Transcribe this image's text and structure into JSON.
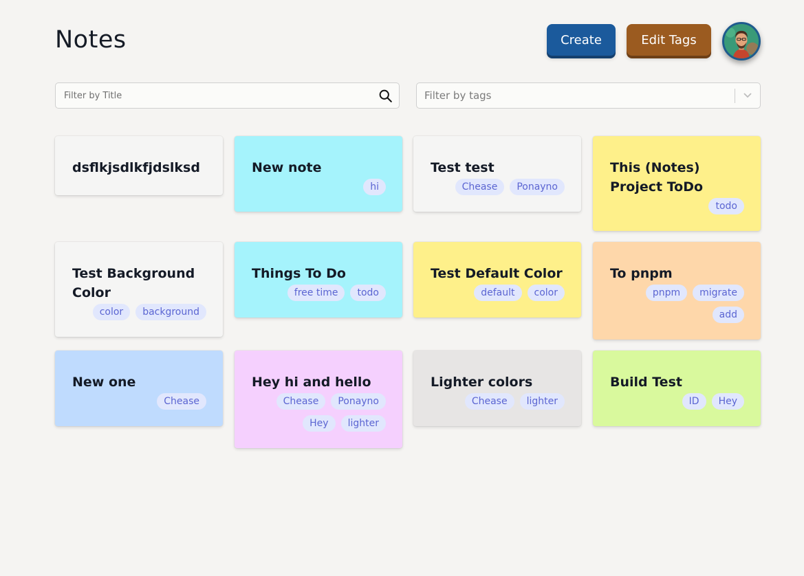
{
  "header": {
    "title": "Notes",
    "create_label": "Create",
    "edit_tags_label": "Edit Tags"
  },
  "filters": {
    "title_placeholder": "Filter by Title",
    "tags_placeholder": "Filter by tags"
  },
  "colors": {
    "white": "#f5f5f4",
    "cyan": "#a5f3fc",
    "yellow": "#fef08a",
    "orange": "#fed7aa",
    "blue": "#bfdbfe",
    "pink": "#f5d0fe",
    "gray": "#e7e5e4",
    "lime": "#d9f99d"
  },
  "notes": [
    {
      "title": "dsflkjsdlkfjdslksd",
      "color": "white",
      "tags": []
    },
    {
      "title": "New note",
      "color": "cyan",
      "tags": [
        "hi"
      ]
    },
    {
      "title": "Test test",
      "color": "white",
      "tags": [
        "Chease",
        "Ponayno"
      ]
    },
    {
      "title": "This (Notes) Project ToDo",
      "color": "yellow",
      "tags": [
        "todo"
      ]
    },
    {
      "title": "Test Background Color",
      "color": "white",
      "tags": [
        "color",
        "background"
      ]
    },
    {
      "title": "Things To Do",
      "color": "cyan",
      "tags": [
        "free time",
        "todo"
      ]
    },
    {
      "title": "Test Default Color",
      "color": "yellow",
      "tags": [
        "default",
        "color"
      ]
    },
    {
      "title": "To pnpm",
      "color": "orange",
      "tags": [
        "pnpm",
        "migrate",
        "add"
      ]
    },
    {
      "title": "New one",
      "color": "blue",
      "tags": [
        "Chease"
      ]
    },
    {
      "title": "Hey hi and hello",
      "color": "pink",
      "tags": [
        "Chease",
        "Ponayno",
        "Hey",
        "lighter"
      ]
    },
    {
      "title": "Lighter colors",
      "color": "gray",
      "tags": [
        "Chease",
        "lighter"
      ]
    },
    {
      "title": "Build Test",
      "color": "lime",
      "tags": [
        "ID",
        "Hey"
      ]
    }
  ]
}
